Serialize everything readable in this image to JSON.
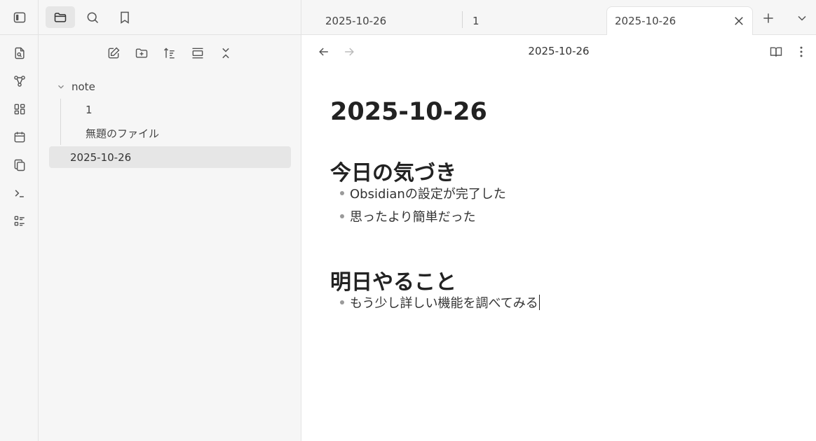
{
  "sidebar": {
    "tree": {
      "folder": "note",
      "children": [
        "1",
        "無題のファイル"
      ],
      "root_file": "2025-10-26"
    }
  },
  "tabs": [
    {
      "label": "2025-10-26"
    },
    {
      "label": "1"
    },
    {
      "label": "2025-10-26"
    }
  ],
  "view": {
    "title": "2025-10-26"
  },
  "document": {
    "title": "2025-10-26",
    "sections": [
      {
        "heading": "今日の気づき",
        "items": [
          "Obsidianの設定が完了した",
          "思ったより簡単だった"
        ]
      },
      {
        "heading": "明日やること",
        "items": [
          "もう少し詳しい機能を調べてみる"
        ]
      }
    ]
  },
  "colors": {
    "panel_bg": "#f6f6f6",
    "active_bg": "#e6e6e6",
    "icon": "#555555"
  },
  "icons": {
    "ribbon": [
      "file-explorer-icon",
      "graph-icon",
      "dashboard-icon",
      "calendar-icon",
      "copy-icon",
      "terminal-icon",
      "list-icon"
    ]
  }
}
